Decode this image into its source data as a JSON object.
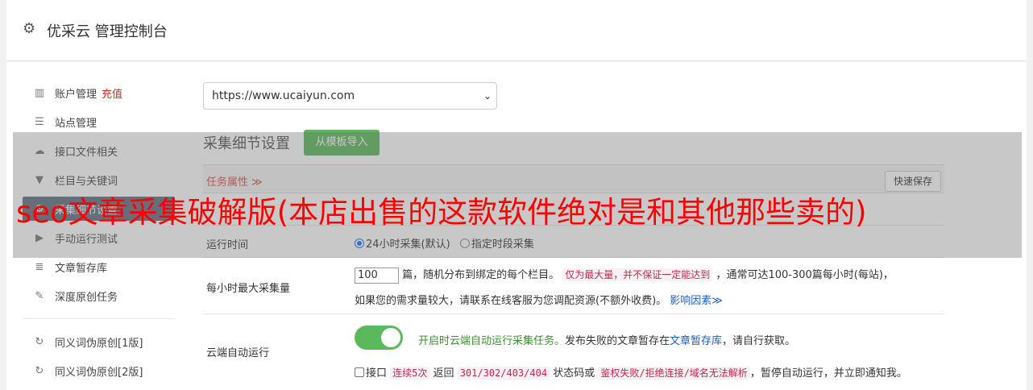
{
  "header": {
    "title": "优采云 管理控制台",
    "icon": "gear-icon"
  },
  "sidebar": {
    "items": [
      {
        "label": "账户管理",
        "extra": "充值",
        "icon": "bar-chart-icon"
      },
      {
        "label": "站点管理",
        "icon": "server-icon"
      },
      {
        "label": "接口文件相关",
        "icon": "cloud-upload-icon"
      },
      {
        "label": "栏目与关键词",
        "icon": "filter-icon"
      },
      {
        "label": "采集细节设置",
        "icon": "gears-icon"
      },
      {
        "label": "手动运行测试",
        "icon": "play-icon"
      },
      {
        "label": "文章暂存库",
        "icon": "database-icon"
      },
      {
        "label": "深度原创任务",
        "icon": "edit-icon"
      },
      {
        "label": "同义词伪原创[1版]",
        "icon": "refresh-icon"
      },
      {
        "label": "同义词伪原创[2版]",
        "icon": "refresh-icon"
      }
    ]
  },
  "main": {
    "site_select": "https://www.ucaiyun.com",
    "section_title": "采集细节设置",
    "import_button": "从模板导入",
    "props_label": "任务属性 ≫",
    "quick_save": "快速保存",
    "run_time": {
      "label": "运行时间",
      "opt1": "24小时采集(默认)",
      "opt2": "指定时段采集"
    },
    "max_per_hour": {
      "label": "每小时最大采集量",
      "value": "100",
      "text1": "篇，随机分布到绑定的每个栏目。",
      "warn": "仅为最大量，并不保证一定能达到",
      "text2": "，通常可达100-300篇每小时(每站)，",
      "line2": "如果您的需求量较大，请联系在线客服为您调配资源(不额外收费)。",
      "link": "影响因素≫"
    },
    "cloud_auto": {
      "label": "云端自动运行",
      "enabled_text": "开启时云端自动运行采集任务。",
      "text_a": "发布失败的文章暂存在",
      "link": "文章暂存库",
      "text_b": "，请自行获取。",
      "cb_label": "接口",
      "code1": "连续5次",
      "text_c": "返回",
      "code2": "301/302/403/404",
      "text_d": "状态码或",
      "code3": "鉴权失败/拒绝连接/域名无法解析",
      "text_e": "，暂停自动运行，并立即通知我。"
    }
  },
  "overlay": {
    "text": "seo文章采集破解版(本店出售的这款软件绝对是和其他那些卖的)"
  },
  "colors": {
    "accent": "#5cb85c",
    "overlay_text": "#ff0000",
    "active_nav": "#5f6f80"
  }
}
